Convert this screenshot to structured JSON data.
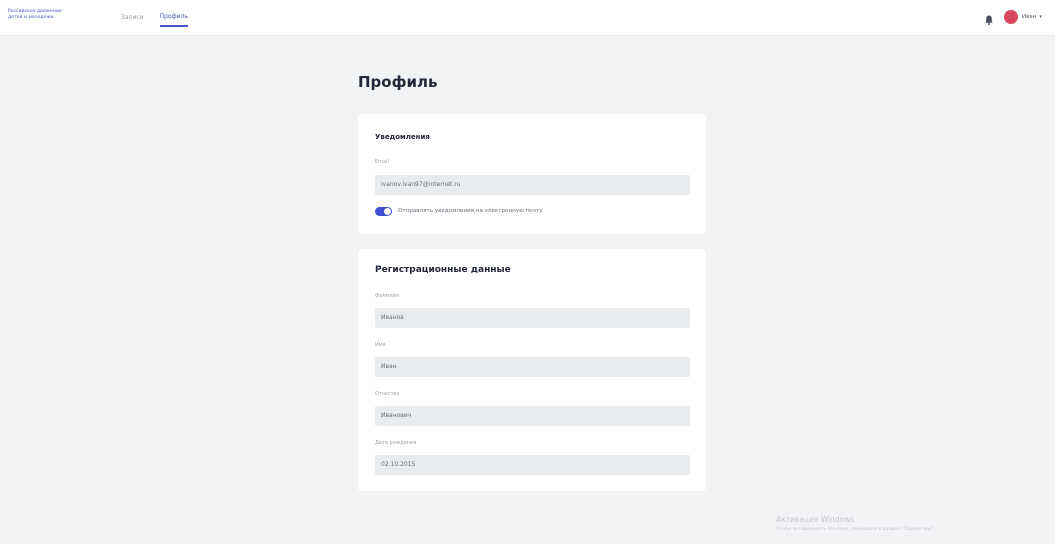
{
  "header": {
    "logo_line1": "Российское движение",
    "logo_line2": "детей и молодёжи",
    "nav": [
      {
        "label": "Записи",
        "active": false
      },
      {
        "label": "Профиль",
        "active": true
      }
    ],
    "bell_icon": "bell-icon",
    "user": {
      "name": "Иван",
      "caret": "▾",
      "avatar_color": "#d9485f"
    }
  },
  "page": {
    "title": "Профиль"
  },
  "notifications": {
    "title": "Уведомления",
    "email": {
      "label": "Email",
      "value": "ivanov.ivan97@internet.ru"
    },
    "toggle": {
      "label": "Отправлять уведомления на электронную почту",
      "on": true,
      "color": "#3f4fd1"
    }
  },
  "registration": {
    "title": "Регистрационные данные",
    "fields": [
      {
        "label": "Фамилия",
        "value": "Иванов"
      },
      {
        "label": "Имя",
        "value": "Иван"
      },
      {
        "label": "Отчество",
        "value": "Иванович"
      },
      {
        "label": "Дата рождения",
        "value": "02.10.2015"
      }
    ]
  },
  "watermark": {
    "line1": "Активация Windows",
    "line2": "Чтобы активировать Windows, перейдите в раздел \"Параметры\"."
  }
}
